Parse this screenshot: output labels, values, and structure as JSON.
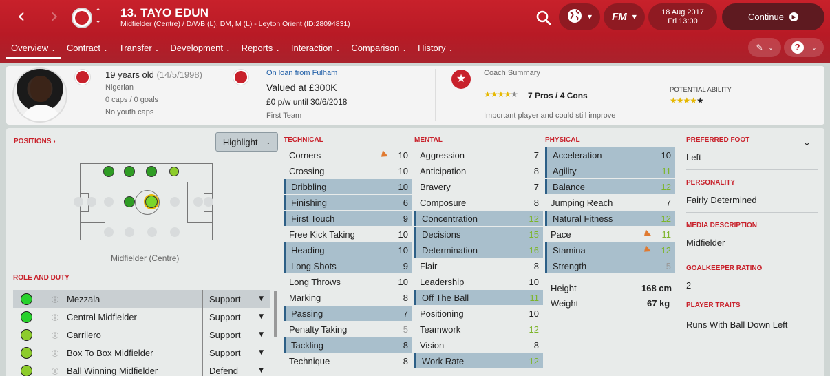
{
  "header": {
    "player_title": "13. TAYO EDUN",
    "player_subtitle": "Midfielder (Centre) / D/WB (L), DM, M (L) - Leyton Orient (ID:28094831)",
    "fm_label": "FM",
    "date_line1": "18 Aug 2017",
    "date_line2": "Fri 13:00",
    "continue_label": "Continue"
  },
  "tabs": [
    "Overview",
    "Contract",
    "Transfer",
    "Development",
    "Reports",
    "Interaction",
    "Comparison",
    "History"
  ],
  "info": {
    "age": "19 years old",
    "dob": "(14/5/1998)",
    "nationality": "Nigerian",
    "caps": "0 caps / 0 goals",
    "youth_caps": "No youth caps",
    "loan": "On loan from Fulham",
    "value": "Valued at £300K",
    "wage": "£0 p/w until 30/6/2018",
    "squad": "First Team",
    "coach_summary_label": "Coach Summary",
    "pros_cons": "7 Pros / 4 Cons",
    "coach_text": "Important player and could still improve",
    "potential_label": "POTENTIAL ABILITY",
    "current_stars": 4,
    "potential_stars": 4.5
  },
  "positions": {
    "label": "POSITIONS",
    "highlight_label": "Highlight",
    "position_caption": "Midfielder (Centre)"
  },
  "roles": {
    "label": "ROLE AND DUTY",
    "items": [
      {
        "name": "Mezzala",
        "duty": "Support",
        "color": "#27d12d"
      },
      {
        "name": "Central Midfielder",
        "duty": "Support",
        "color": "#27d12d"
      },
      {
        "name": "Carrilero",
        "duty": "Support",
        "color": "#8dcc2b"
      },
      {
        "name": "Box To Box Midfielder",
        "duty": "Support",
        "color": "#8dcc2b"
      },
      {
        "name": "Ball Winning Midfielder",
        "duty": "Defend",
        "color": "#8dcc2b"
      }
    ]
  },
  "technical": {
    "label": "TECHNICAL",
    "items": [
      {
        "name": "Corners",
        "value": "10"
      },
      {
        "name": "Crossing",
        "value": "10"
      },
      {
        "name": "Dribbling",
        "value": "10"
      },
      {
        "name": "Finishing",
        "value": "6"
      },
      {
        "name": "First Touch",
        "value": "9"
      },
      {
        "name": "Free Kick Taking",
        "value": "10"
      },
      {
        "name": "Heading",
        "value": "10"
      },
      {
        "name": "Long Shots",
        "value": "9"
      },
      {
        "name": "Long Throws",
        "value": "10"
      },
      {
        "name": "Marking",
        "value": "8"
      },
      {
        "name": "Passing",
        "value": "7"
      },
      {
        "name": "Penalty Taking",
        "value": "5"
      },
      {
        "name": "Tackling",
        "value": "8"
      },
      {
        "name": "Technique",
        "value": "8"
      }
    ]
  },
  "mental": {
    "label": "MENTAL",
    "items": [
      {
        "name": "Aggression",
        "value": "7"
      },
      {
        "name": "Anticipation",
        "value": "8"
      },
      {
        "name": "Bravery",
        "value": "7"
      },
      {
        "name": "Composure",
        "value": "8"
      },
      {
        "name": "Concentration",
        "value": "12"
      },
      {
        "name": "Decisions",
        "value": "15"
      },
      {
        "name": "Determination",
        "value": "16"
      },
      {
        "name": "Flair",
        "value": "8"
      },
      {
        "name": "Leadership",
        "value": "10"
      },
      {
        "name": "Off The Ball",
        "value": "11"
      },
      {
        "name": "Positioning",
        "value": "10"
      },
      {
        "name": "Teamwork",
        "value": "12"
      },
      {
        "name": "Vision",
        "value": "8"
      },
      {
        "name": "Work Rate",
        "value": "12"
      }
    ]
  },
  "physical": {
    "label": "PHYSICAL",
    "items": [
      {
        "name": "Acceleration",
        "value": "10"
      },
      {
        "name": "Agility",
        "value": "11"
      },
      {
        "name": "Balance",
        "value": "12"
      },
      {
        "name": "Jumping Reach",
        "value": "7"
      },
      {
        "name": "Natural Fitness",
        "value": "12"
      },
      {
        "name": "Pace",
        "value": "11"
      },
      {
        "name": "Stamina",
        "value": "12"
      },
      {
        "name": "Strength",
        "value": "5"
      }
    ],
    "height_label": "Height",
    "height": "168 cm",
    "weight_label": "Weight",
    "weight": "67 kg"
  },
  "sidebar": {
    "preferred_foot_label": "PREFERRED FOOT",
    "preferred_foot": "Left",
    "personality_label": "PERSONALITY",
    "personality": "Fairly Determined",
    "media_label": "MEDIA DESCRIPTION",
    "media": "Midfielder",
    "gk_label": "GOALKEEPER RATING",
    "gk": "2",
    "traits_label": "PLAYER TRAITS",
    "traits": "Runs With Ball Down Left"
  },
  "colors": {
    "brand": "#c8212b",
    "highlight_row": "#a9bfcc",
    "green_value": "#7db52a"
  }
}
